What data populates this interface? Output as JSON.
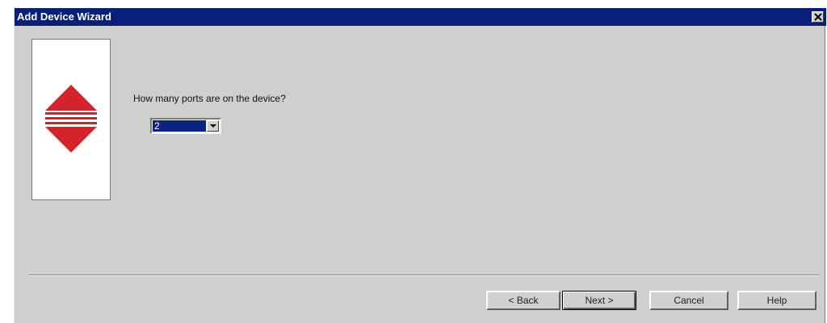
{
  "window": {
    "title": "Add Device Wizard"
  },
  "question": "How many ports are on the device?",
  "ports_select": {
    "value": "2"
  },
  "buttons": {
    "back": "< Back",
    "next": "Next >",
    "cancel": "Cancel",
    "help": "Help"
  },
  "colors": {
    "titlebar": "#0a1f7a",
    "logo_red": "#d2232a",
    "dialog_bg": "#cfcfcf"
  },
  "icons": {
    "close": "close-icon",
    "logo": "red-arrows-logo-icon",
    "dropdown": "chevron-down-icon"
  }
}
